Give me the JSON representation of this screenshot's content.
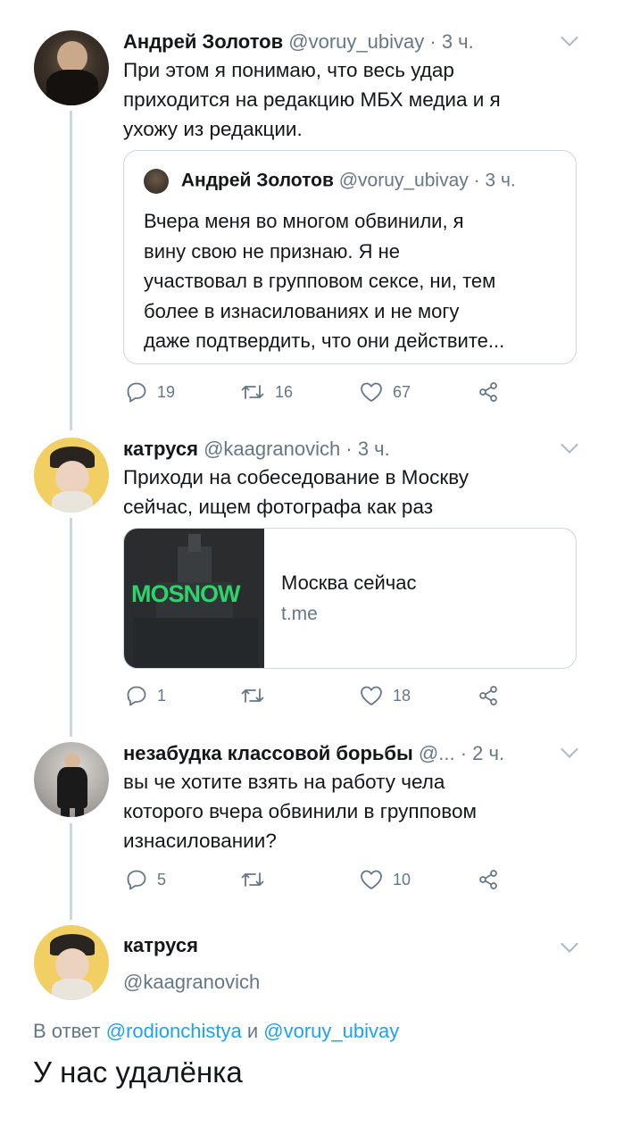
{
  "tweets": [
    {
      "name": "Андрей Золотов",
      "handle": "@voruy_ubivay",
      "time": "· 3 ч.",
      "text_lines": [
        "При этом я понимаю, что весь удар",
        "приходится на редакцию МБХ медиа и я",
        "ухожу из редакции."
      ],
      "quote": {
        "name": "Андрей Золотов",
        "handle": "@voruy_ubivay",
        "time": "· 3 ч.",
        "text_lines": [
          "Вчера меня во многом обвинили, я",
          "вину свою не признаю. Я не",
          "участвовал в групповом сексе, ни, тем",
          "более в изнасилованиях и не могу",
          "даже подтвердить, что они действите..."
        ]
      },
      "reply_count": "19",
      "retweet_count": "16",
      "like_count": "67"
    },
    {
      "name": "катруся",
      "handle": "@kaagranovich",
      "time": "· 3 ч.",
      "text_lines": [
        "Приходи на собеседование в Москву",
        "сейчас, ищем фотографа как раз"
      ],
      "card": {
        "image_text": "MOSNOW",
        "title": "Москва сейчас",
        "domain": "t.me"
      },
      "reply_count": "1",
      "retweet_count": "",
      "like_count": "18"
    },
    {
      "name": "незабудка классовой борьбы",
      "handle": "@...",
      "time": "· 2 ч.",
      "text_lines": [
        "вы че хотите взять на работу чела",
        "которого вчера обвинили в групповом",
        "изнасиловании?"
      ],
      "reply_count": "5",
      "retweet_count": "",
      "like_count": "10"
    }
  ],
  "main_tweet": {
    "name": "катруся",
    "handle": "@kaagranovich",
    "reply_prefix": "В ответ",
    "reply_mention_1": "@rodionchistya",
    "reply_joiner": "и",
    "reply_mention_2": "@voruy_ubivay",
    "text": "У нас удалёнка"
  },
  "colors": {
    "link": "#1da1f2",
    "meta": "#657786",
    "border": "#ccd6dd",
    "mosnow_green": "#2fd36b"
  }
}
